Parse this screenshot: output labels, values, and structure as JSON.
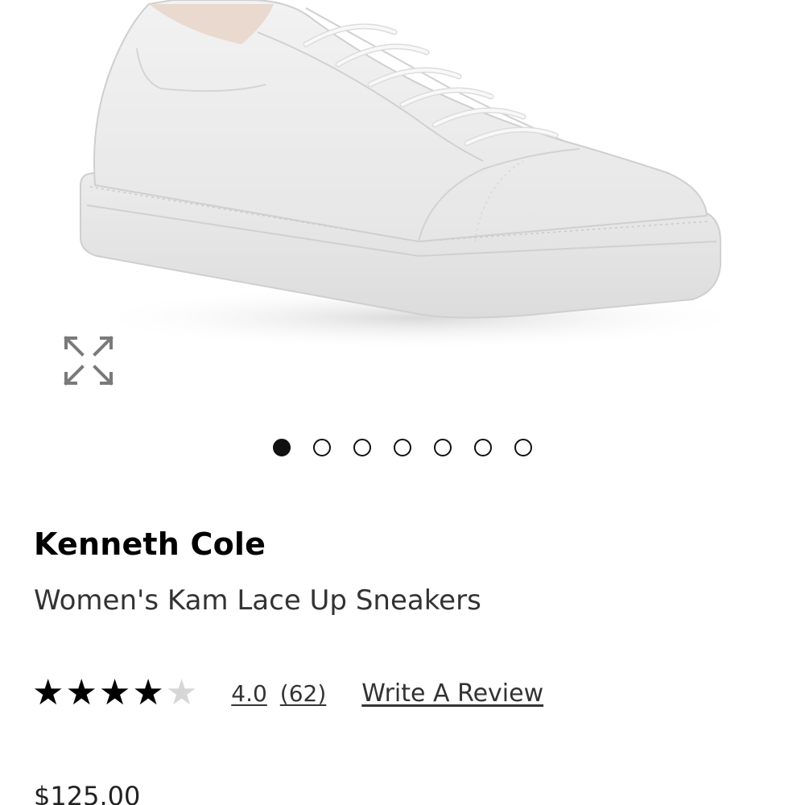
{
  "product": {
    "brand": "Kenneth Cole",
    "name": "Women's Kam Lace Up Sneakers",
    "price": "$125.00",
    "image_alt": "white-leather-sneaker-icon"
  },
  "gallery": {
    "total_images": 7,
    "active_index": 0,
    "expand_icon": "expand-arrows-icon"
  },
  "rating": {
    "value": "4.0",
    "count": "(62)",
    "stars_filled": 4,
    "stars_total": 5,
    "write_review_label": "Write A Review"
  },
  "colors": {
    "star_filled": "#000000",
    "star_empty": "#d6d6d6",
    "text_primary": "#000000",
    "text_secondary": "#333333"
  }
}
